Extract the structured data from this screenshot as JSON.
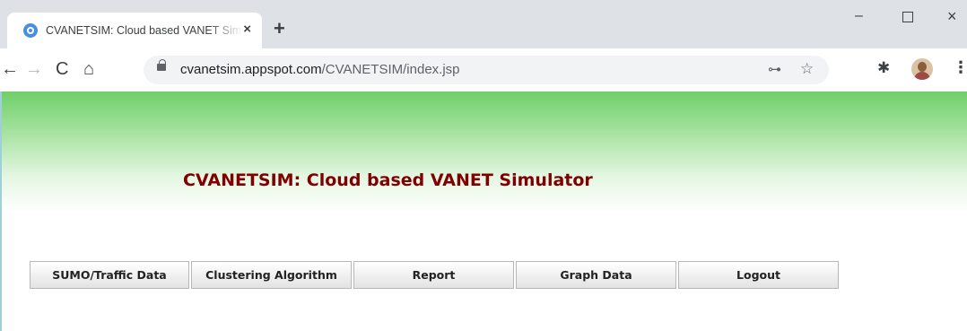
{
  "browser": {
    "tab_title": "CVANETSIM: Cloud based VANET Simulator",
    "tab_close": "×",
    "new_tab": "+",
    "window_controls": {
      "minimize": "–",
      "close": "×"
    },
    "url_host": "cvanetsim.appspot.com",
    "url_path": "/CVANETSIM/index.jsp",
    "icons": {
      "back": "←",
      "forward": "→",
      "reload": "C",
      "home": "⌂",
      "key": "⊶",
      "star": "☆",
      "extensions": "✱",
      "menu": "⋮"
    }
  },
  "page": {
    "title": "CVANETSIM: Cloud based VANET Simulator",
    "menu": [
      {
        "label": "SUMO/Traffic Data"
      },
      {
        "label": "Clustering Algorithm"
      },
      {
        "label": "Report"
      },
      {
        "label": "Graph Data"
      },
      {
        "label": "Logout"
      }
    ]
  },
  "colors": {
    "title": "#800000",
    "banner_top": "#6fcf6a",
    "tabstrip": "#dee1e6"
  }
}
